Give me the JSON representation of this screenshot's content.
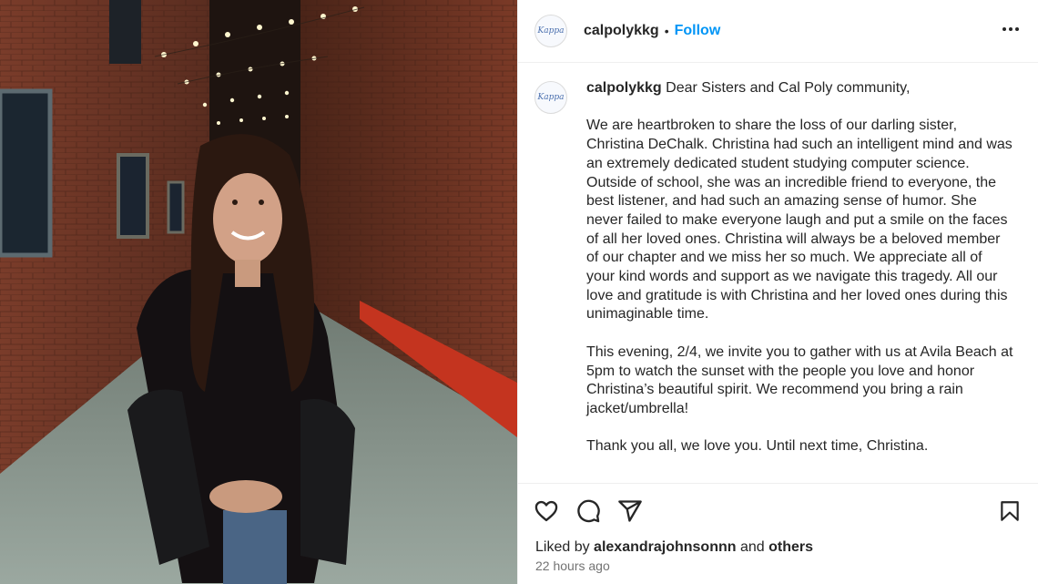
{
  "account": {
    "username": "calpolykkg",
    "separator": "•",
    "follow_label": "Follow",
    "more_label": "•••",
    "avatar_text": "Kappa"
  },
  "caption": {
    "username": "calpolykkg",
    "greeting": "Dear Sisters and Cal Poly community,",
    "paragraph1": "We are heartbroken to share the loss of our darling sister, Christina DeChalk. Christina had such an intelligent mind and was an extremely dedicated student studying computer science. Outside of school, she was an incredible friend to everyone, the best listener, and had such an amazing sense of humor. She never failed to make everyone laugh and put a smile on the faces of all her loved ones. Christina will always be a beloved member of our chapter and we miss her so much. We appreciate all of your kind words and support as we navigate this tragedy. All our love and gratitude is with Christina and her loved ones during this unimaginable time.",
    "paragraph2": "This evening, 2/4, we invite you to gather with us at Avila Beach at 5pm to watch the sunset with the people you love and honor Christina’s beautiful spirit. We recommend you bring a rain jacket/umbrella!",
    "paragraph3": "Thank you all, we love you. Until next time, Christina."
  },
  "actions": {
    "like_icon": "heart-icon",
    "comment_icon": "comment-icon",
    "share_icon": "share-icon",
    "save_icon": "bookmark-icon"
  },
  "likes": {
    "prefix": "Liked by",
    "user": "alexandrajohnsonnn",
    "conjunction": "and",
    "others": "others"
  },
  "timestamp": "22 hours ago",
  "colors": {
    "accent": "#0095f6",
    "text": "#262626",
    "muted": "#737373"
  }
}
